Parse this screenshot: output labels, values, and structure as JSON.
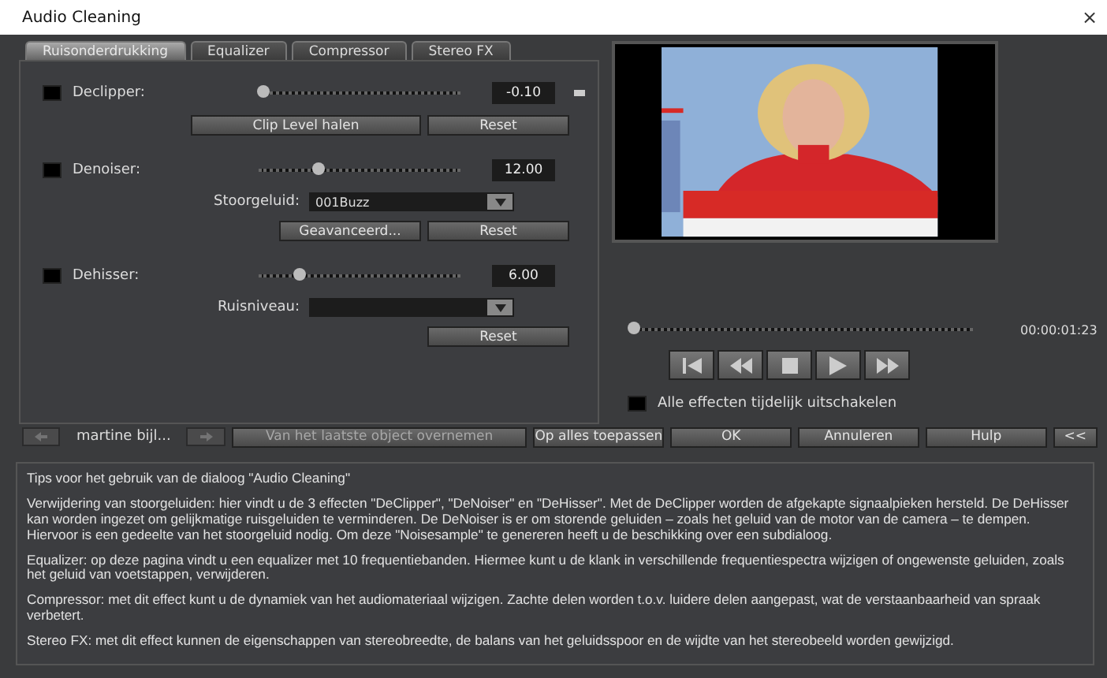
{
  "window": {
    "title": "Audio Cleaning",
    "close": "×"
  },
  "tabs": [
    {
      "label": "Ruisonderdrukking",
      "selected": true
    },
    {
      "label": "Equalizer",
      "selected": false
    },
    {
      "label": "Compressor",
      "selected": false
    },
    {
      "label": "Stereo FX",
      "selected": false
    }
  ],
  "effects": [
    {
      "label": "Declipper:",
      "checked": false,
      "level": 0.02,
      "value": "-0.10",
      "indicator": true,
      "buttons": [
        {
          "label": "Clip Level halen",
          "wide": true
        },
        {
          "label": "Reset",
          "wide": false
        }
      ]
    },
    {
      "label": "Denoiser:",
      "checked": false,
      "level": 0.3,
      "value": "12.00",
      "indicator": false,
      "dropdown": {
        "label": "Stoorgeluid:",
        "value": "001Buzz"
      },
      "buttons": [
        {
          "label": "Geavanceerd...",
          "wide": false
        },
        {
          "label": "Reset",
          "wide": false
        }
      ]
    },
    {
      "label": "Dehisser:",
      "checked": false,
      "level": 0.2,
      "value": "6.00",
      "indicator": false,
      "dropdown": {
        "label": "Ruisniveau:"
      },
      "buttons": [
        {
          "label": "Reset",
          "wide": false
        }
      ]
    }
  ],
  "player": {
    "position": {
      "level": 0
    },
    "time": "00:00:01:23",
    "bypass": {
      "label": "Alle effecten tijdelijk uitschakelen",
      "checked": false
    }
  },
  "footer": {
    "object": "martine bijl...",
    "buttons": [
      {
        "label": "Van het laatste object overnemen",
        "disabled": true
      },
      {
        "label": "Op alles toepassen",
        "disabled": false
      },
      {
        "label": "OK",
        "disabled": false
      },
      {
        "label": "Annuleren",
        "disabled": false
      },
      {
        "label": "Hulp",
        "disabled": false
      },
      {
        "label": "<<",
        "disabled": false
      }
    ],
    "prev_disabled": true,
    "next_disabled": true
  },
  "tips": [
    "Tips voor het gebruik van de dialoog \"Audio Cleaning\"",
    "Verwijdering van stoorgeluiden: hier vindt u de 3 effecten \"DeClipper\", \"DeNoiser\" en \"DeHisser\". Met de DeClipper worden de afgekapte signaalpieken hersteld. De DeHisser kan worden ingezet om gelijkmatige ruisgeluiden te verminderen. De DeNoiser is er om storende geluiden – zoals het geluid van de motor van de camera – te dempen. Hiervoor is een gedeelte van het stoorgeluid nodig. Om deze \"Noisesample\" te genereren heeft u de beschikking over een subdialoog.",
    "Equalizer: op deze pagina vindt u een equalizer met 10 frequentiebanden. Hiermee kunt u de klank in verschillende frequentiespectra wijzigen of ongewenste geluiden, zoals het geluid van voetstappen, verwijderen.",
    "Compressor: met dit effect kunt u de dynamiek van het audiomateriaal wijzigen. Zachte delen worden t.o.v. luidere delen aangepast, wat de verstaanbaarheid van spraak verbetert.",
    "Stereo FX: met dit effect kunnen de eigenschappen van stereobreedte, de balans van het geluidsspoor en de wijdte van het stereobeeld worden gewijzigd."
  ]
}
